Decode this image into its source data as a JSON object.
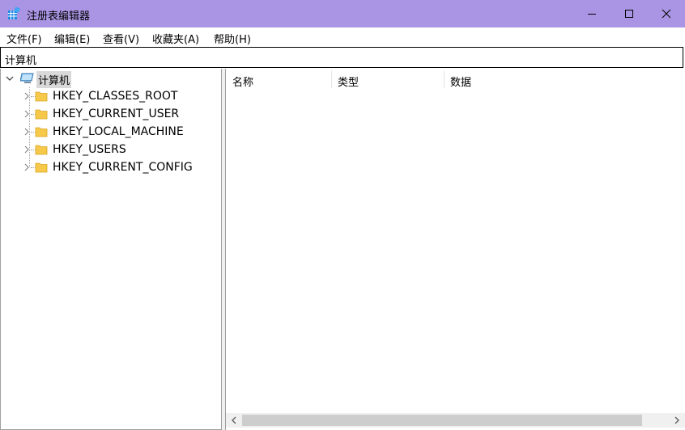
{
  "window": {
    "title": "注册表编辑器",
    "accent_color": "#a995e3",
    "icons": [
      "registry-editor-icon",
      "minimize-icon",
      "maximize-icon",
      "close-icon"
    ]
  },
  "menu": {
    "items": [
      "文件(F)",
      "编辑(E)",
      "查看(V)",
      "收藏夹(A)",
      "帮助(H)"
    ]
  },
  "address": {
    "path": "计算机"
  },
  "tree": {
    "root": {
      "label": "计算机",
      "expanded": true,
      "icon": "computer-icon"
    },
    "children": [
      {
        "label": "HKEY_CLASSES_ROOT",
        "icon": "folder-icon"
      },
      {
        "label": "HKEY_CURRENT_USER",
        "icon": "folder-icon"
      },
      {
        "label": "HKEY_LOCAL_MACHINE",
        "icon": "folder-icon"
      },
      {
        "label": "HKEY_USERS",
        "icon": "folder-icon"
      },
      {
        "label": "HKEY_CURRENT_CONFIG",
        "icon": "folder-icon"
      }
    ]
  },
  "list": {
    "columns": [
      "名称",
      "类型",
      "数据"
    ]
  }
}
